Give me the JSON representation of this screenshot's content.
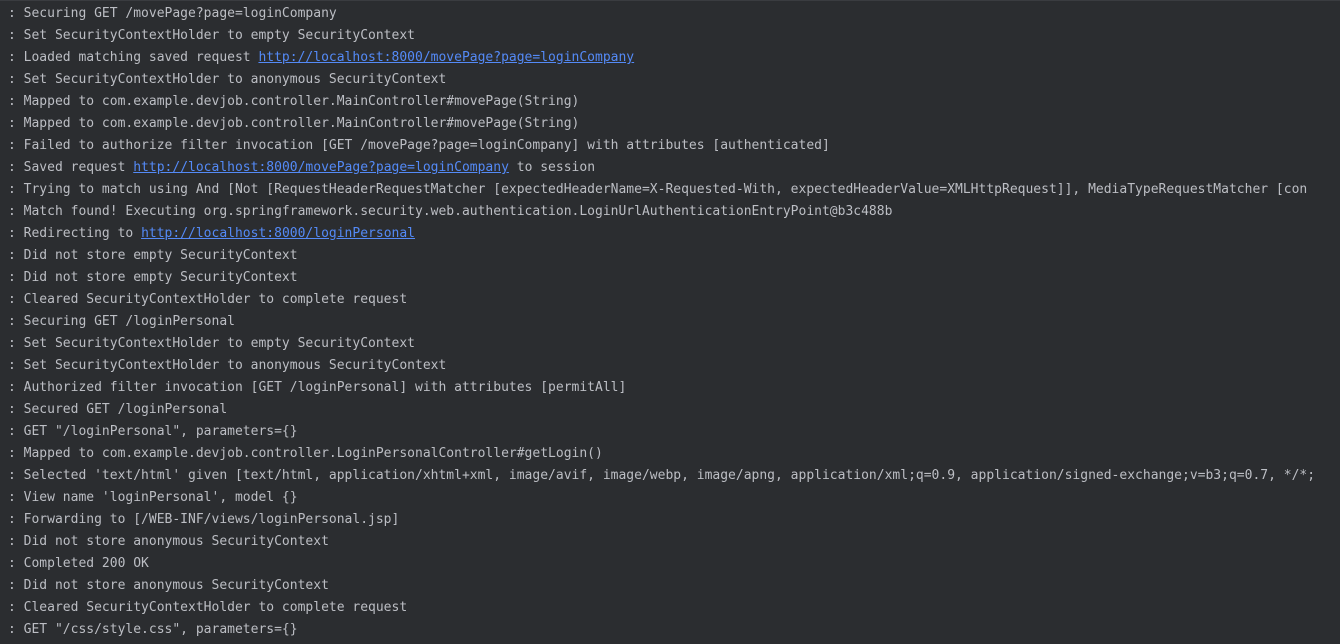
{
  "colors": {
    "background": "#2b2d30",
    "text": "#bcbec4",
    "link": "#548af7"
  },
  "log": [
    {
      "segments": [
        {
          "text": ": Securing GET /movePage?page=loginCompany"
        }
      ]
    },
    {
      "segments": [
        {
          "text": ": Set SecurityContextHolder to empty SecurityContext"
        }
      ]
    },
    {
      "segments": [
        {
          "text": ": Loaded matching saved request "
        },
        {
          "text": "http://localhost:8000/movePage?page=loginCompany",
          "link": true
        }
      ]
    },
    {
      "segments": [
        {
          "text": ": Set SecurityContextHolder to anonymous SecurityContext"
        }
      ]
    },
    {
      "segments": [
        {
          "text": ": Mapped to com.example.devjob.controller.MainController#movePage(String)"
        }
      ]
    },
    {
      "segments": [
        {
          "text": ": Mapped to com.example.devjob.controller.MainController#movePage(String)"
        }
      ]
    },
    {
      "segments": [
        {
          "text": ": Failed to authorize filter invocation [GET /movePage?page=loginCompany] with attributes [authenticated]"
        }
      ]
    },
    {
      "segments": [
        {
          "text": ": Saved request "
        },
        {
          "text": "http://localhost:8000/movePage?page=loginCompany",
          "link": true
        },
        {
          "text": " to session"
        }
      ]
    },
    {
      "segments": [
        {
          "text": ": Trying to match using And [Not [RequestHeaderRequestMatcher [expectedHeaderName=X-Requested-With, expectedHeaderValue=XMLHttpRequest]], MediaTypeRequestMatcher [con"
        }
      ]
    },
    {
      "segments": [
        {
          "text": ": Match found! Executing org.springframework.security.web.authentication.LoginUrlAuthenticationEntryPoint@b3c488b"
        }
      ]
    },
    {
      "segments": [
        {
          "text": ": Redirecting to "
        },
        {
          "text": "http://localhost:8000/loginPersonal",
          "link": true
        }
      ]
    },
    {
      "segments": [
        {
          "text": ": Did not store empty SecurityContext"
        }
      ]
    },
    {
      "segments": [
        {
          "text": ": Did not store empty SecurityContext"
        }
      ]
    },
    {
      "segments": [
        {
          "text": ": Cleared SecurityContextHolder to complete request"
        }
      ]
    },
    {
      "segments": [
        {
          "text": ": Securing GET /loginPersonal"
        }
      ]
    },
    {
      "segments": [
        {
          "text": ": Set SecurityContextHolder to empty SecurityContext"
        }
      ]
    },
    {
      "segments": [
        {
          "text": ": Set SecurityContextHolder to anonymous SecurityContext"
        }
      ]
    },
    {
      "segments": [
        {
          "text": ": Authorized filter invocation [GET /loginPersonal] with attributes [permitAll]"
        }
      ]
    },
    {
      "segments": [
        {
          "text": ": Secured GET /loginPersonal"
        }
      ]
    },
    {
      "segments": [
        {
          "text": ": GET \"/loginPersonal\", parameters={}"
        }
      ]
    },
    {
      "segments": [
        {
          "text": ": Mapped to com.example.devjob.controller.LoginPersonalController#getLogin()"
        }
      ]
    },
    {
      "segments": [
        {
          "text": ": Selected 'text/html' given [text/html, application/xhtml+xml, image/avif, image/webp, image/apng, application/xml;q=0.9, application/signed-exchange;v=b3;q=0.7, */*;"
        }
      ]
    },
    {
      "segments": [
        {
          "text": ": View name 'loginPersonal', model {}"
        }
      ]
    },
    {
      "segments": [
        {
          "text": ": Forwarding to [/WEB-INF/views/loginPersonal.jsp]"
        }
      ]
    },
    {
      "segments": [
        {
          "text": ": Did not store anonymous SecurityContext"
        }
      ]
    },
    {
      "segments": [
        {
          "text": ": Completed 200 OK"
        }
      ]
    },
    {
      "segments": [
        {
          "text": ": Did not store anonymous SecurityContext"
        }
      ]
    },
    {
      "segments": [
        {
          "text": ": Cleared SecurityContextHolder to complete request"
        }
      ]
    },
    {
      "segments": [
        {
          "text": ": GET \"/css/style.css\", parameters={}"
        }
      ]
    }
  ]
}
